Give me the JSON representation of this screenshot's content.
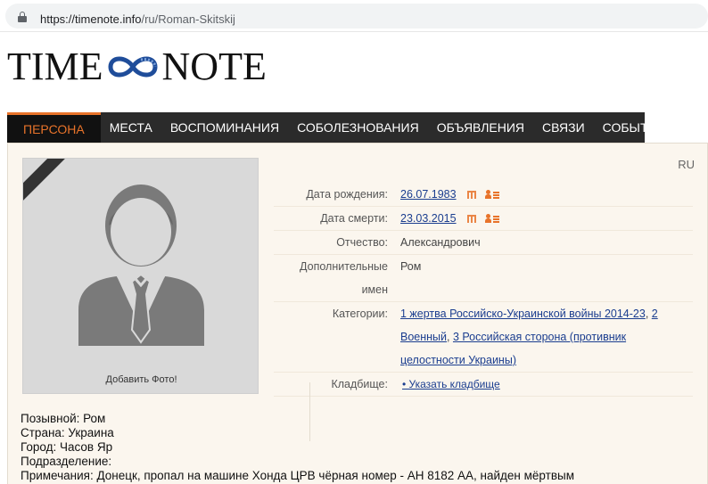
{
  "browser": {
    "url_host": "https://timenote.info",
    "url_path": "/ru/Roman-Skitskij"
  },
  "logo": {
    "left": "TIME",
    "right": "NOTE"
  },
  "nav": {
    "items": [
      "ПЕРСОНА",
      "МЕСТА",
      "ВОСПОМИНАНИЯ",
      "СОБОЛЕЗНОВАНИЯ",
      "ОБЪЯВЛЕНИЯ",
      "СВЯЗИ",
      "СОБЫТИЯ"
    ],
    "active": "ПЕРСОНА"
  },
  "profile": {
    "lang": "RU",
    "add_photo": "Добавить Фото!",
    "birth_label": "Дата рождения:",
    "birth_date": "26.07.1983",
    "death_label": "Дата смерти:",
    "death_date": "23.03.2015",
    "patronymic_label": "Отчество:",
    "patronymic": "Александрович",
    "extra_names_label": "Дополнительные имен",
    "extra_names": "Ром",
    "categories_label": "Категории:",
    "categories": [
      "1 жертва Российско-Украинской войны 2014-23",
      "2 Военный",
      "3 Российская сторона (противник целостности Украины)"
    ],
    "cemetery_label": "Кладбище:",
    "cemetery_link": "• Указать кладбище"
  },
  "details": {
    "callsign": "Позывной: Ром",
    "country": "Страна: Украина",
    "city": "Город: Часов Яр",
    "unit": "Подразделение:",
    "notes": "Примечания: Донецк, пропал на машине Хонда ЦРВ чёрная номер - АН 8182 АА, найден мёртвым"
  },
  "colors": {
    "accent": "#e8732a",
    "nav_bg": "#2b2b2b",
    "link": "#1a3d8f",
    "panel_bg": "#fbf6ee"
  }
}
